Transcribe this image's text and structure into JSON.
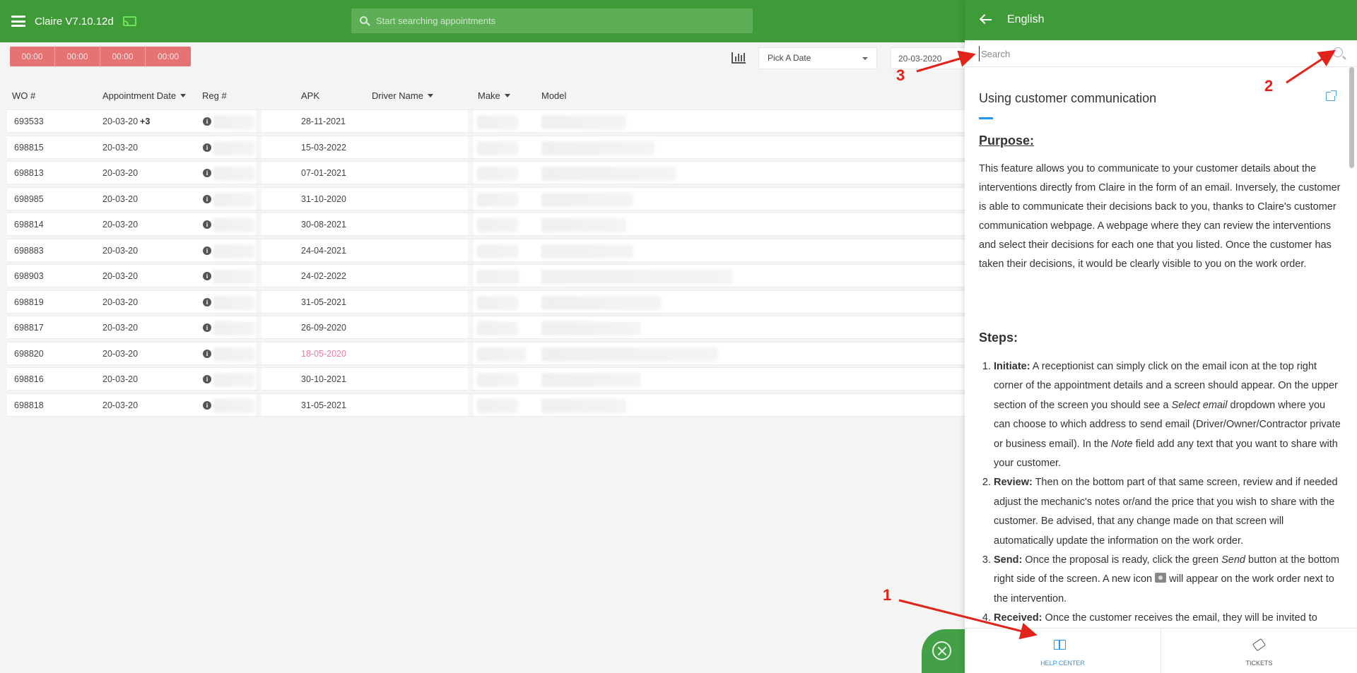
{
  "app": {
    "title": "Claire V7.10.12d",
    "search_placeholder": "Start searching appointments"
  },
  "toolbar": {
    "timers": [
      "00:00",
      "00:00",
      "00:00",
      "00:00"
    ],
    "pick_date_label": "Pick A Date",
    "date_value": "20-03-2020"
  },
  "table": {
    "headers": {
      "wo": "WO #",
      "appointment_date": "Appointment Date",
      "reg": "Reg #",
      "apk": "APK",
      "driver_name": "Driver Name",
      "make": "Make",
      "model": "Model"
    },
    "rows": [
      {
        "wo": "693533",
        "date": "20-03-20",
        "extra": "+3",
        "apk": "28-11-2021",
        "apk_expired": false
      },
      {
        "wo": "698815",
        "date": "20-03-20",
        "extra": "",
        "apk": "15-03-2022",
        "apk_expired": false
      },
      {
        "wo": "698813",
        "date": "20-03-20",
        "extra": "",
        "apk": "07-01-2021",
        "apk_expired": false
      },
      {
        "wo": "698985",
        "date": "20-03-20",
        "extra": "",
        "apk": "31-10-2020",
        "apk_expired": false
      },
      {
        "wo": "698814",
        "date": "20-03-20",
        "extra": "",
        "apk": "30-08-2021",
        "apk_expired": false
      },
      {
        "wo": "698883",
        "date": "20-03-20",
        "extra": "",
        "apk": "24-04-2021",
        "apk_expired": false
      },
      {
        "wo": "698903",
        "date": "20-03-20",
        "extra": "",
        "apk": "24-02-2022",
        "apk_expired": false
      },
      {
        "wo": "698819",
        "date": "20-03-20",
        "extra": "",
        "apk": "31-05-2021",
        "apk_expired": false
      },
      {
        "wo": "698817",
        "date": "20-03-20",
        "extra": "",
        "apk": "26-09-2020",
        "apk_expired": false
      },
      {
        "wo": "698820",
        "date": "20-03-20",
        "extra": "",
        "apk": "18-05-2020",
        "apk_expired": true
      },
      {
        "wo": "698816",
        "date": "20-03-20",
        "extra": "",
        "apk": "30-10-2021",
        "apk_expired": false
      },
      {
        "wo": "698818",
        "date": "20-03-20",
        "extra": "",
        "apk": "31-05-2021",
        "apk_expired": false
      }
    ]
  },
  "help_panel": {
    "language": "English",
    "search_placeholder": "Search",
    "article_title": "Using customer communication",
    "purpose_heading": "Purpose:",
    "purpose_text": "This feature allows you to communicate to your customer details about the interventions directly from Claire in the form of an email. Inversely, the customer is able to communicate their decisions back to you, thanks to Claire's customer communication webpage. A webpage where they can review the interventions and select their decisions for each one that you listed. Once the customer has taken their decisions, it would be clearly visible to you on the work order.",
    "steps_heading": "Steps:",
    "steps": [
      {
        "label": "Initiate:",
        "pre": " A receptionist can simply click on the email icon at the top right corner of the appointment details and a screen should appear. On the upper section of the screen you should see a ",
        "em1": "Select email",
        "mid": " dropdown where you can choose to which address to send email (Driver/Owner/Contractor private or business email). In the ",
        "em2": "Note",
        "post": " field add any text that you want to share with your customer."
      },
      {
        "label": "Review:",
        "text": " Then on the bottom part of that same screen, review and if needed adjust the mechanic's notes or/and the price that you wish to share with the customer. Be advised, that any change made on that screen will automatically update the information on the work order."
      },
      {
        "label": "Send:",
        "pre": " Once the proposal is ready, click the green ",
        "em1": "Send",
        "mid": " button at the bottom right side of the screen. A new icon ",
        "post": " will appear on the work order next to the intervention."
      },
      {
        "label": "Received:",
        "text": " Once the customer receives the email, they will be invited to"
      }
    ],
    "tabs": [
      {
        "label": "HELP CENTER",
        "active": true
      },
      {
        "label": "TICKETS",
        "active": false
      }
    ]
  },
  "annotations": [
    "1",
    "2",
    "3"
  ],
  "colors": {
    "primary_green": "#3f9b38",
    "timer_red": "#e57373",
    "accent_blue": "#2196f3",
    "annotation_red": "#e2231a",
    "expired_pink": "#e879a7"
  }
}
